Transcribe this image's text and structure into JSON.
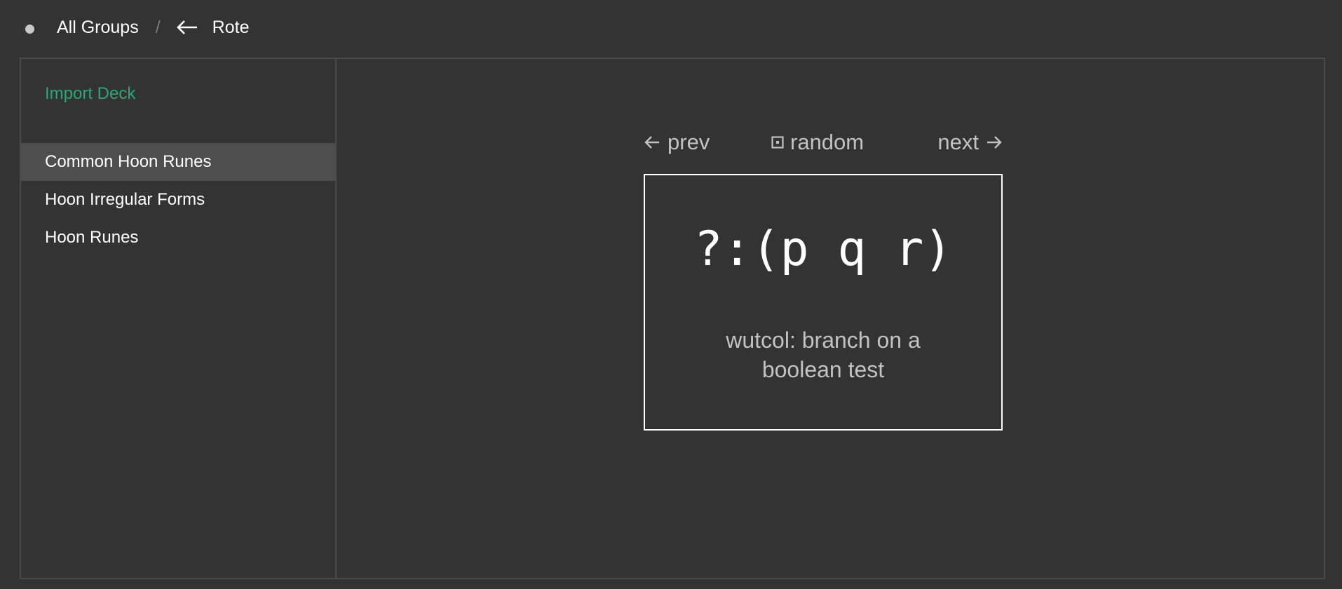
{
  "breadcrumb": {
    "all_groups": "All Groups",
    "separator": "/",
    "app_name": "Rote"
  },
  "sidebar": {
    "import_label": "Import Deck",
    "items": [
      {
        "label": "Common Hoon Runes",
        "active": true
      },
      {
        "label": "Hoon Irregular Forms",
        "active": false
      },
      {
        "label": "Hoon Runes",
        "active": false
      }
    ]
  },
  "nav": {
    "prev_label": "prev",
    "random_label": "random",
    "next_label": "next"
  },
  "card": {
    "front": "?:(p q r)",
    "back": "wutcol: branch on a boolean test"
  },
  "colors": {
    "background": "#333333",
    "accent": "#2aa779",
    "active_item": "#4e4e4e",
    "muted_text": "#c2c2c2",
    "border": "#4a4a4a"
  },
  "icons": {
    "status": "status-dot-icon",
    "back": "arrow-left-icon",
    "prev": "arrow-left-icon",
    "random": "dice-icon",
    "next": "arrow-right-icon"
  }
}
